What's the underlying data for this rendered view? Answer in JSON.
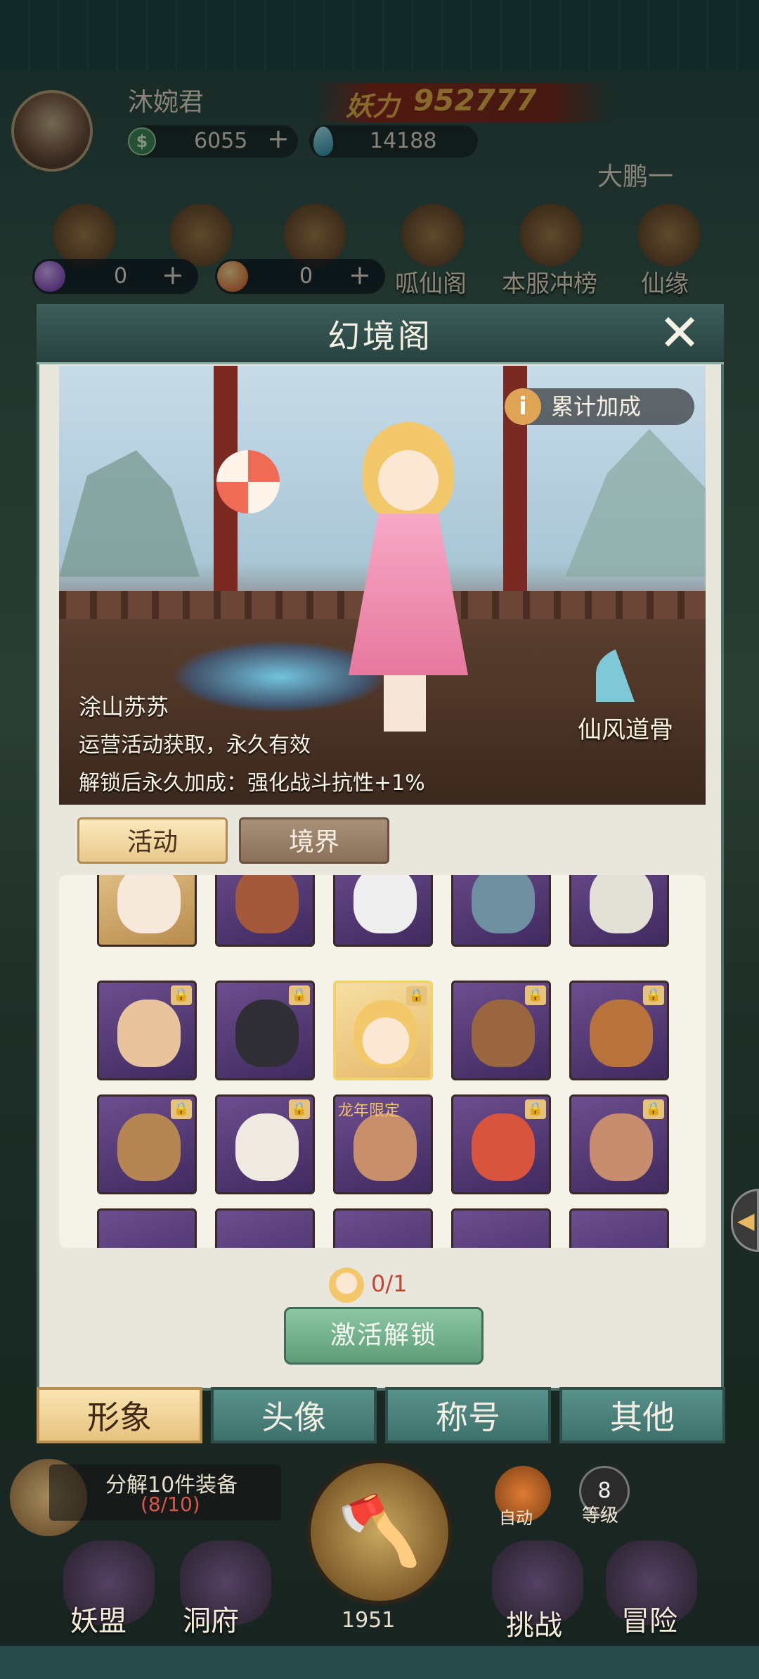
{
  "player": {
    "name": "沐婉君",
    "power_label": "妖力",
    "power_value": "952777",
    "currency_coin": "6055",
    "currency_jade": "14188",
    "server": "大鹏一"
  },
  "shop_icons": [
    {
      "label": "呱仙阁",
      "icon": "cauldron-icon"
    },
    {
      "label": "本服冲榜",
      "icon": "shrine-icon"
    },
    {
      "label": "仙缘",
      "icon": "lotus-icon"
    }
  ],
  "mini_currency": [
    {
      "value": "0",
      "icon": "purple-orb-icon"
    },
    {
      "value": "0",
      "icon": "orange-orb-icon"
    }
  ],
  "panel": {
    "title": "幻境阁",
    "bonus_label": "累计加成",
    "skin_name": "涂山苏苏",
    "source_text": "运营活动获取，永久有效",
    "unlock_bonus_text": "解锁后永久加成：强化战斗抗性+1%",
    "set_name": "仙风道骨",
    "tabs": [
      "活动",
      "境界"
    ],
    "active_tab": "活动",
    "limited_label": "龙年限定",
    "progress": "0/1",
    "unlock_button": "激活解锁"
  },
  "categories": [
    "形象",
    "头像",
    "称号",
    "其他"
  ],
  "active_category": "形象",
  "bottom": {
    "quest_text": "分解10件装备",
    "quest_progress": "(8/10)",
    "auto_label": "自动",
    "level_value": "8",
    "level_label": "等级",
    "exp_count": "1951",
    "nav": [
      "妖盟",
      "洞府",
      "挑战",
      "冒险"
    ]
  },
  "colors": {
    "accent_gold": "#e8b64b",
    "tab_active": "#e9c88a",
    "category_inactive": "#3d706b",
    "unlock_button": "#5e9c79",
    "progress_red": "#c4452f"
  }
}
